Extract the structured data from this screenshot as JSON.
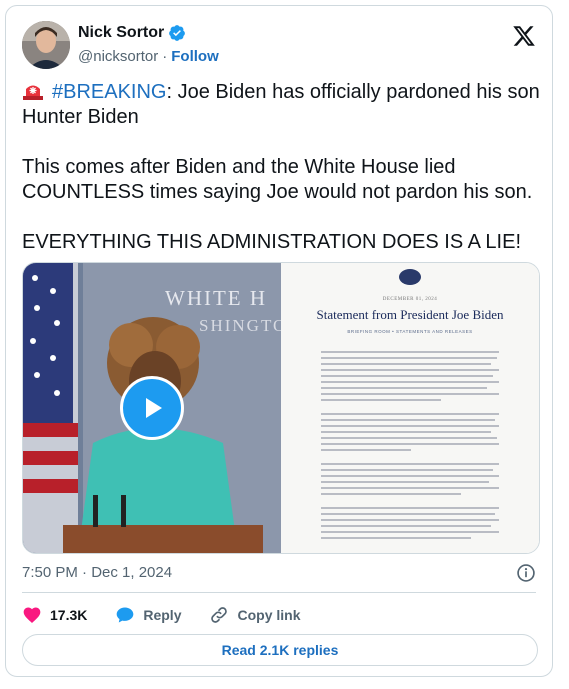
{
  "author": {
    "name": "Nick Sortor",
    "handle": "@nicksortor",
    "follow_label": "Follow",
    "separator": "·"
  },
  "tweet": {
    "hashtag": "#BREAKING",
    "line1_rest": ": Joe Biden has officially pardoned his son Hunter Biden",
    "line2": "This comes after Biden and the White House lied COUNTLESS times saying Joe would not pardon his son.",
    "line3": "EVERYTHING THIS ADMINISTRATION DOES IS A LIE!"
  },
  "media": {
    "video_sign_text_1": "WHITE H",
    "video_sign_text_2": "SHINGTO",
    "doc_date": "DECEMBER 01, 2024",
    "doc_title": "Statement from President Joe Biden",
    "doc_links": "BRIEFING ROOM  •  STATEMENTS AND RELEASES"
  },
  "meta": {
    "timestamp": "7:50 PM · Dec 1, 2024"
  },
  "actions": {
    "likes": "17.3K",
    "reply_label": "Reply",
    "copy_label": "Copy link",
    "read_replies": "Read 2.1K replies"
  },
  "colors": {
    "link": "#1d6fbf",
    "like": "#f91880",
    "reply": "#1d9bf0",
    "border": "#cfd9de"
  }
}
